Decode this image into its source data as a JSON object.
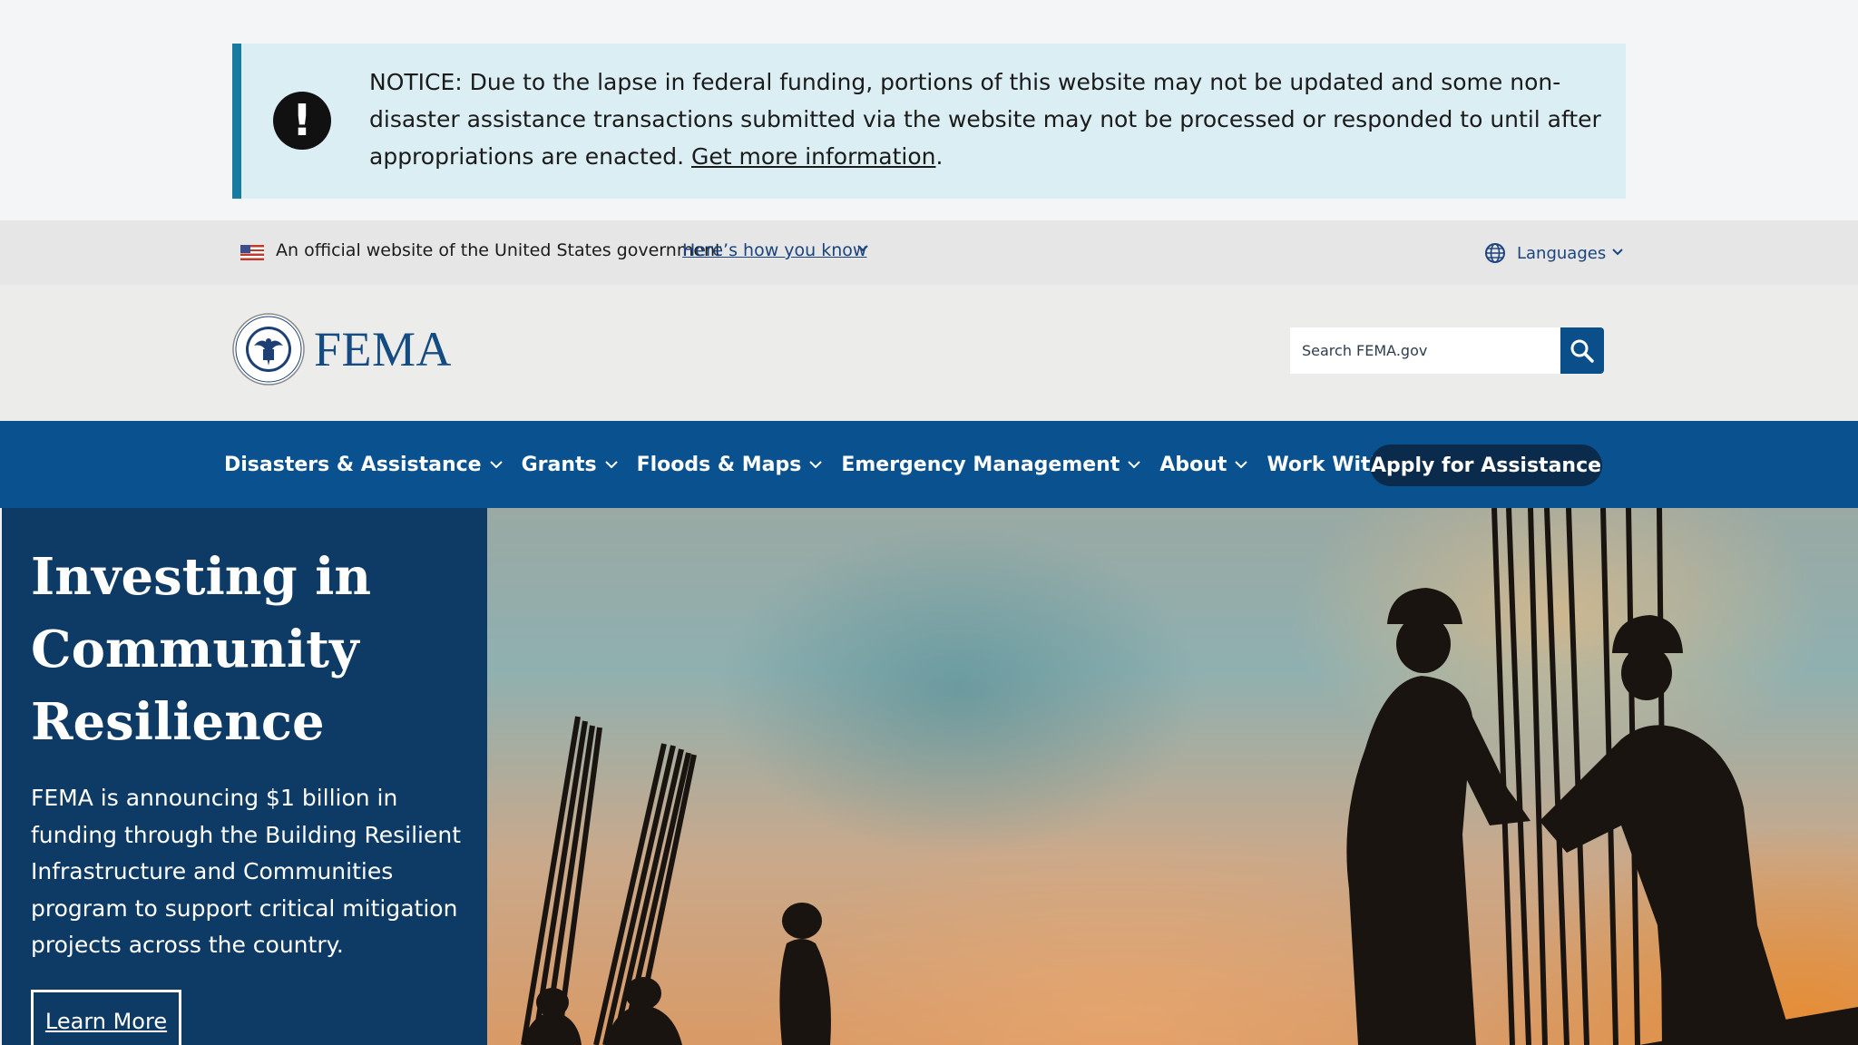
{
  "notice": {
    "text": "NOTICE: Due to the lapse in federal funding, portions of this website may not be updated and some non-disaster assistance transactions submitted via the website may not be processed or responded to until after appropriations are enacted.",
    "link_text": "Get more information",
    "trailing": "."
  },
  "gov_banner": {
    "official_text": "An official website of the United States government",
    "how_you_know": "Here’s how you know",
    "languages": "Languages"
  },
  "header": {
    "logo_text": "FEMA",
    "search_placeholder": "Search FEMA.gov"
  },
  "nav": {
    "items": [
      {
        "label": "Disasters & Assistance"
      },
      {
        "label": "Grants"
      },
      {
        "label": "Floods & Maps"
      },
      {
        "label": "Emergency Management"
      },
      {
        "label": "About"
      },
      {
        "label": "Work With Us"
      }
    ],
    "apply_label": "Apply for Assistance"
  },
  "hero": {
    "title": "Investing in Community Resilience",
    "text": "FEMA is announcing $1 billion in funding through the Building Resilient Infrastructure and Communities program to support critical mitigation projects across the country.",
    "button_label": "Learn More"
  },
  "colors": {
    "nav_background": "#0a5190",
    "hero_panel": "#0d3b66",
    "notice_background": "#daeef3",
    "notice_accent": "#1a7ba1"
  }
}
